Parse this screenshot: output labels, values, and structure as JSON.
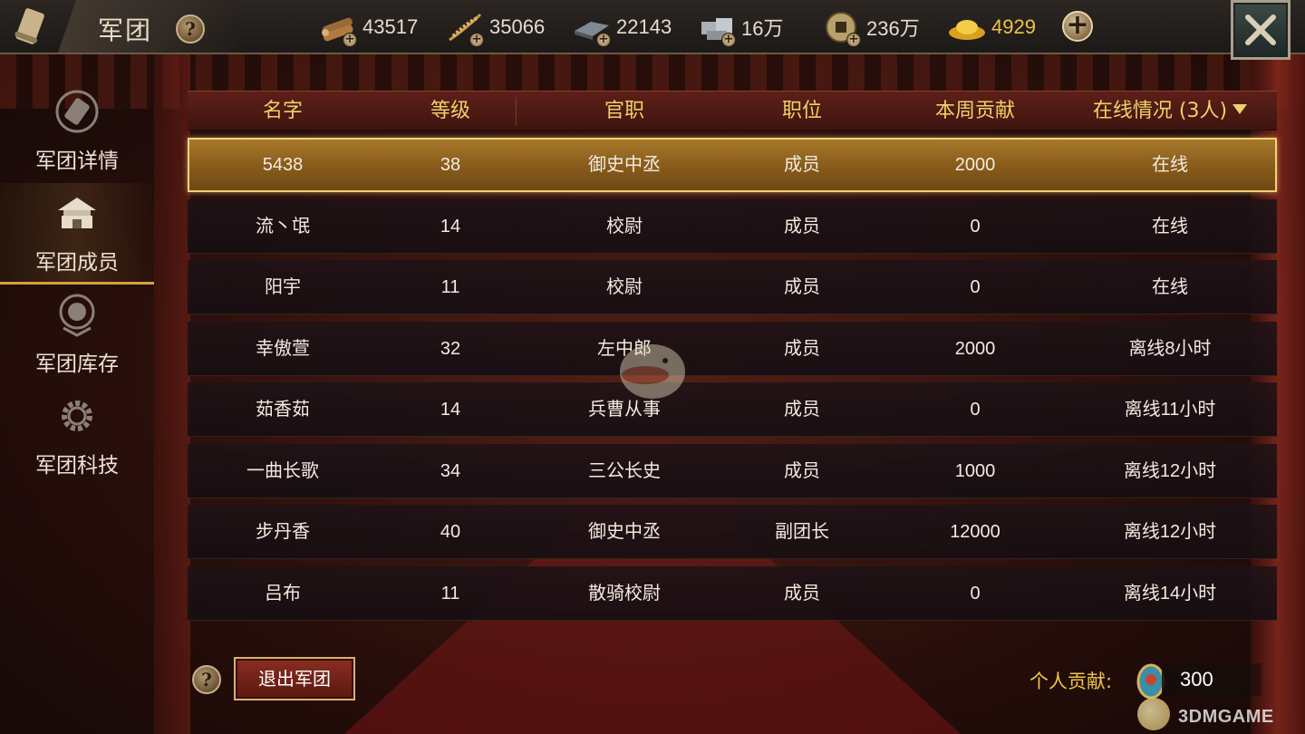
{
  "header": {
    "title": "军团",
    "resources": [
      {
        "icon": "wood-icon",
        "value": "43517"
      },
      {
        "icon": "grain-icon",
        "value": "35066"
      },
      {
        "icon": "iron-icon",
        "value": "22143"
      },
      {
        "icon": "stone-icon",
        "value": "16万"
      },
      {
        "icon": "coin-icon",
        "value": "236万"
      },
      {
        "icon": "gold-ingot-icon",
        "value": "4929"
      }
    ],
    "plus_glyph": "+",
    "help_glyph": "?"
  },
  "sidebar": {
    "items": [
      {
        "label": "军团详情",
        "icon": "scroll-icon",
        "active": false
      },
      {
        "label": "军团成员",
        "icon": "palace-icon",
        "active": true
      },
      {
        "label": "军团库存",
        "icon": "coin-seal-icon",
        "active": false
      },
      {
        "label": "军团科技",
        "icon": "gear-icon",
        "active": false
      }
    ]
  },
  "table": {
    "columns": [
      "名字",
      "等级",
      "官职",
      "职位",
      "本周贡献",
      "在线情况 (3人)"
    ],
    "rows": [
      {
        "name": "5438",
        "level": "38",
        "office": "御史中丞",
        "position": "成员",
        "contribution": "2000",
        "status": "在线",
        "selected": true
      },
      {
        "name": "流丶氓",
        "level": "14",
        "office": "校尉",
        "position": "成员",
        "contribution": "0",
        "status": "在线"
      },
      {
        "name": "阳宇",
        "level": "11",
        "office": "校尉",
        "position": "成员",
        "contribution": "0",
        "status": "在线"
      },
      {
        "name": "幸傲萱",
        "level": "32",
        "office": "左中郎",
        "position": "成员",
        "contribution": "2000",
        "status": "离线8小时"
      },
      {
        "name": "茹香茹",
        "level": "14",
        "office": "兵曹从事",
        "position": "成员",
        "contribution": "0",
        "status": "离线11小时"
      },
      {
        "name": "一曲长歌",
        "level": "34",
        "office": "三公长史",
        "position": "成员",
        "contribution": "1000",
        "status": "离线12小时"
      },
      {
        "name": "步丹香",
        "level": "40",
        "office": "御史中丞",
        "position": "副团长",
        "contribution": "12000",
        "status": "离线12小时"
      },
      {
        "name": "吕布",
        "level": "11",
        "office": "散骑校尉",
        "position": "成员",
        "contribution": "0",
        "status": "离线14小时"
      }
    ]
  },
  "footer": {
    "quit_label": "退出军团",
    "contribution_label": "个人贡献:",
    "contribution_value": "300",
    "watermark": "3DMGAME"
  },
  "colors": {
    "header_text": "#f0d06a",
    "selected_row": "#8a5d1c",
    "gold_value": "#f1c248"
  }
}
